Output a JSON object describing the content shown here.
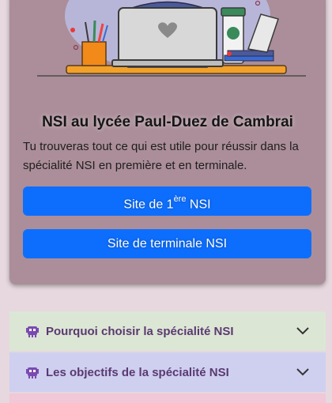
{
  "card": {
    "title": "NSI au lycée Paul-Duez de Cambrai",
    "text": "Tu trouveras tout ce qui est utile pour réussir dans la spécialité NSI en première et en terminale.",
    "button1": {
      "prefix": "Site de 1",
      "sup": "ère",
      "suffix": " NSI"
    },
    "button2": {
      "label": "Site de terminale NSI"
    }
  },
  "accordion": [
    {
      "label": "Pourquoi choisir la spécialité NSI",
      "icon": "alien-monster-icon",
      "color": "#dce6d5"
    },
    {
      "label": "Les objectifs de la spécialité NSI",
      "icon": "alien-monster-icon",
      "color": "#cfcff0"
    }
  ],
  "colors": {
    "background": "#e6d8de",
    "card": "#ab8e99",
    "primary_button": "#0d6efd",
    "accordion_label": "#5a3a70"
  }
}
